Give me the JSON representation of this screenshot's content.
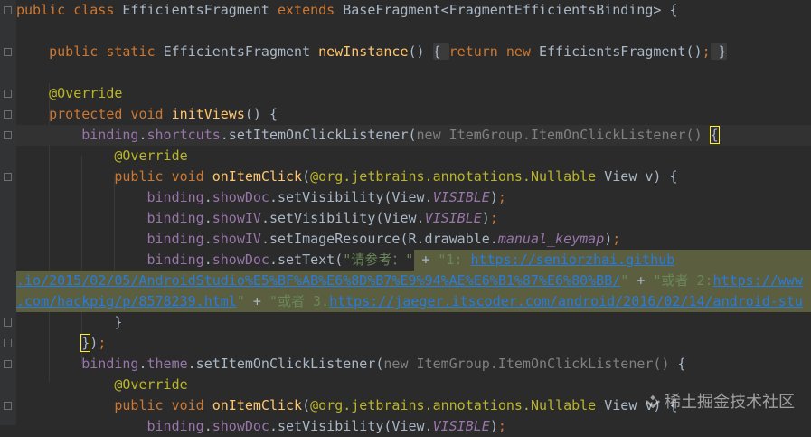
{
  "editor": {
    "lines": [
      {
        "tokens": [
          {
            "c": "kw",
            "t": "public class "
          },
          {
            "c": "id",
            "t": "EfficientsFragment "
          },
          {
            "c": "kw",
            "t": "extends "
          },
          {
            "c": "id",
            "t": "BaseFragment<FragmentEfficientsBinding> {"
          }
        ]
      },
      {
        "tokens": []
      },
      {
        "tokens": [
          {
            "c": "id",
            "t": "    "
          },
          {
            "c": "kw",
            "t": "public static "
          },
          {
            "c": "id",
            "t": "EfficientsFragment "
          },
          {
            "c": "fn",
            "t": "newInstance"
          },
          {
            "c": "id",
            "t": "() "
          },
          {
            "c": "fold-inline",
            "t": "{ "
          },
          {
            "c": "kw",
            "t": "return new "
          },
          {
            "c": "id",
            "t": "EfficientsFragment()"
          },
          {
            "c": "kw",
            "t": ";"
          },
          {
            "c": "fold-inline",
            "t": " }"
          }
        ]
      },
      {
        "tokens": []
      },
      {
        "tokens": [
          {
            "c": "id",
            "t": "    "
          },
          {
            "c": "ann",
            "t": "@Override"
          }
        ]
      },
      {
        "tokens": [
          {
            "c": "id",
            "t": "    "
          },
          {
            "c": "kw",
            "t": "protected void "
          },
          {
            "c": "fn",
            "t": "initViews"
          },
          {
            "c": "id",
            "t": "() {"
          }
        ]
      },
      {
        "tokens": [
          {
            "c": "id",
            "t": "        "
          },
          {
            "c": "field",
            "t": "binding"
          },
          {
            "c": "id",
            "t": "."
          },
          {
            "c": "field",
            "t": "shortcuts"
          },
          {
            "c": "id",
            "t": ".setItemOnClickListener("
          },
          {
            "c": "cmt",
            "t": "new ItemGroup.ItemOnClickListener() "
          },
          {
            "c": "brace",
            "t": "{"
          }
        ]
      },
      {
        "tokens": [
          {
            "c": "id",
            "t": "            "
          },
          {
            "c": "ann",
            "t": "@Override"
          }
        ]
      },
      {
        "tokens": [
          {
            "c": "id",
            "t": "            "
          },
          {
            "c": "kw",
            "t": "public void "
          },
          {
            "c": "fn",
            "t": "onItemClick"
          },
          {
            "c": "id",
            "t": "("
          },
          {
            "c": "ann",
            "t": "@org.jetbrains.annotations."
          },
          {
            "c": "ann",
            "t": "Nullable "
          },
          {
            "c": "id",
            "t": "View v) {"
          }
        ]
      },
      {
        "tokens": [
          {
            "c": "id",
            "t": "                "
          },
          {
            "c": "field",
            "t": "binding"
          },
          {
            "c": "id",
            "t": "."
          },
          {
            "c": "field",
            "t": "showDoc"
          },
          {
            "c": "id",
            "t": ".setVisibility(View."
          },
          {
            "c": "ital",
            "t": "VISIBLE"
          },
          {
            "c": "id",
            "t": ")"
          },
          {
            "c": "kw",
            "t": ";"
          }
        ]
      },
      {
        "tokens": [
          {
            "c": "id",
            "t": "                "
          },
          {
            "c": "field",
            "t": "binding"
          },
          {
            "c": "id",
            "t": "."
          },
          {
            "c": "field",
            "t": "showIV"
          },
          {
            "c": "id",
            "t": ".setVisibility(View."
          },
          {
            "c": "ital",
            "t": "VISIBLE"
          },
          {
            "c": "id",
            "t": ")"
          },
          {
            "c": "kw",
            "t": ";"
          }
        ]
      },
      {
        "tokens": [
          {
            "c": "id",
            "t": "                "
          },
          {
            "c": "field",
            "t": "binding"
          },
          {
            "c": "id",
            "t": "."
          },
          {
            "c": "field",
            "t": "showIV"
          },
          {
            "c": "id",
            "t": ".setImageResource(R.drawable."
          },
          {
            "c": "ital",
            "t": "manual_keymap"
          },
          {
            "c": "id",
            "t": ")"
          },
          {
            "c": "kw",
            "t": ";"
          }
        ]
      },
      {
        "tokens": [
          {
            "c": "id",
            "t": "                "
          },
          {
            "c": "field",
            "t": "binding"
          },
          {
            "c": "id",
            "t": "."
          },
          {
            "c": "field",
            "t": "showDoc"
          },
          {
            "c": "id",
            "t": ".setText("
          },
          {
            "c": "str",
            "t": "\"请参考：\" "
          },
          {
            "c": "id",
            "t": "+ "
          },
          {
            "c": "str",
            "t": "\"1: "
          },
          {
            "c": "link",
            "t": "https://seniorzhai.github"
          }
        ],
        "sel": true
      },
      {
        "tokens": [
          {
            "c": "link",
            "t": ".io/2015/02/05/AndroidStudio%E5%BF%AB%E6%8D%B7%E9%94%AE%E6%B1%87%E6%80%BB/"
          },
          {
            "c": "str",
            "t": "\" "
          },
          {
            "c": "id",
            "t": "+ "
          },
          {
            "c": "str",
            "t": "\"或者 2:"
          },
          {
            "c": "link",
            "t": "https://www"
          }
        ],
        "sel": true
      },
      {
        "tokens": [
          {
            "c": "link",
            "t": ".com/hackpig/p/8578239.html"
          },
          {
            "c": "str",
            "t": "\" "
          },
          {
            "c": "id",
            "t": "+ "
          },
          {
            "c": "str",
            "t": "\"或者 3."
          },
          {
            "c": "link",
            "t": "https://jaeger.itscoder.com/android/2016/02/14/android-stu"
          }
        ],
        "sel": true
      },
      {
        "tokens": [
          {
            "c": "id",
            "t": "            }"
          }
        ]
      },
      {
        "tokens": [
          {
            "c": "id",
            "t": "        "
          },
          {
            "c": "brace",
            "t": "}"
          },
          {
            "c": "id",
            "t": ")"
          },
          {
            "c": "kw",
            "t": ";"
          }
        ]
      },
      {
        "tokens": [
          {
            "c": "id",
            "t": "        "
          },
          {
            "c": "field",
            "t": "binding"
          },
          {
            "c": "id",
            "t": "."
          },
          {
            "c": "field",
            "t": "theme"
          },
          {
            "c": "id",
            "t": ".setItemOnClickListener("
          },
          {
            "c": "cmt",
            "t": "new ItemGroup.ItemOnClickListener() "
          },
          {
            "c": "id",
            "t": "{"
          }
        ]
      },
      {
        "tokens": [
          {
            "c": "id",
            "t": "            "
          },
          {
            "c": "ann",
            "t": "@Override"
          }
        ]
      },
      {
        "tokens": [
          {
            "c": "id",
            "t": "            "
          },
          {
            "c": "kw",
            "t": "public void "
          },
          {
            "c": "fn",
            "t": "onItemClick"
          },
          {
            "c": "id",
            "t": "("
          },
          {
            "c": "ann",
            "t": "@org.jetbrains.annotations."
          },
          {
            "c": "ann",
            "t": "Nullable "
          },
          {
            "c": "id",
            "t": "View v) {"
          }
        ]
      },
      {
        "tokens": [
          {
            "c": "id",
            "t": "                "
          },
          {
            "c": "field",
            "t": "binding"
          },
          {
            "c": "id",
            "t": "."
          },
          {
            "c": "field",
            "t": "showDoc"
          },
          {
            "c": "id",
            "t": ".setVisibility(View."
          },
          {
            "c": "ital",
            "t": "VISIBLE"
          },
          {
            "c": "id",
            "t": ")"
          },
          {
            "c": "kw",
            "t": ";"
          }
        ]
      }
    ]
  },
  "watermark": {
    "text": "稀土掘金技术社区"
  },
  "colors": {
    "background": "#2b2b2b",
    "keyword": "#cc7832",
    "function": "#ffc66d",
    "annotation": "#bbb529",
    "field": "#9876aa",
    "string": "#6a8759",
    "link": "#287bde",
    "selection": "#5b5f3f"
  }
}
